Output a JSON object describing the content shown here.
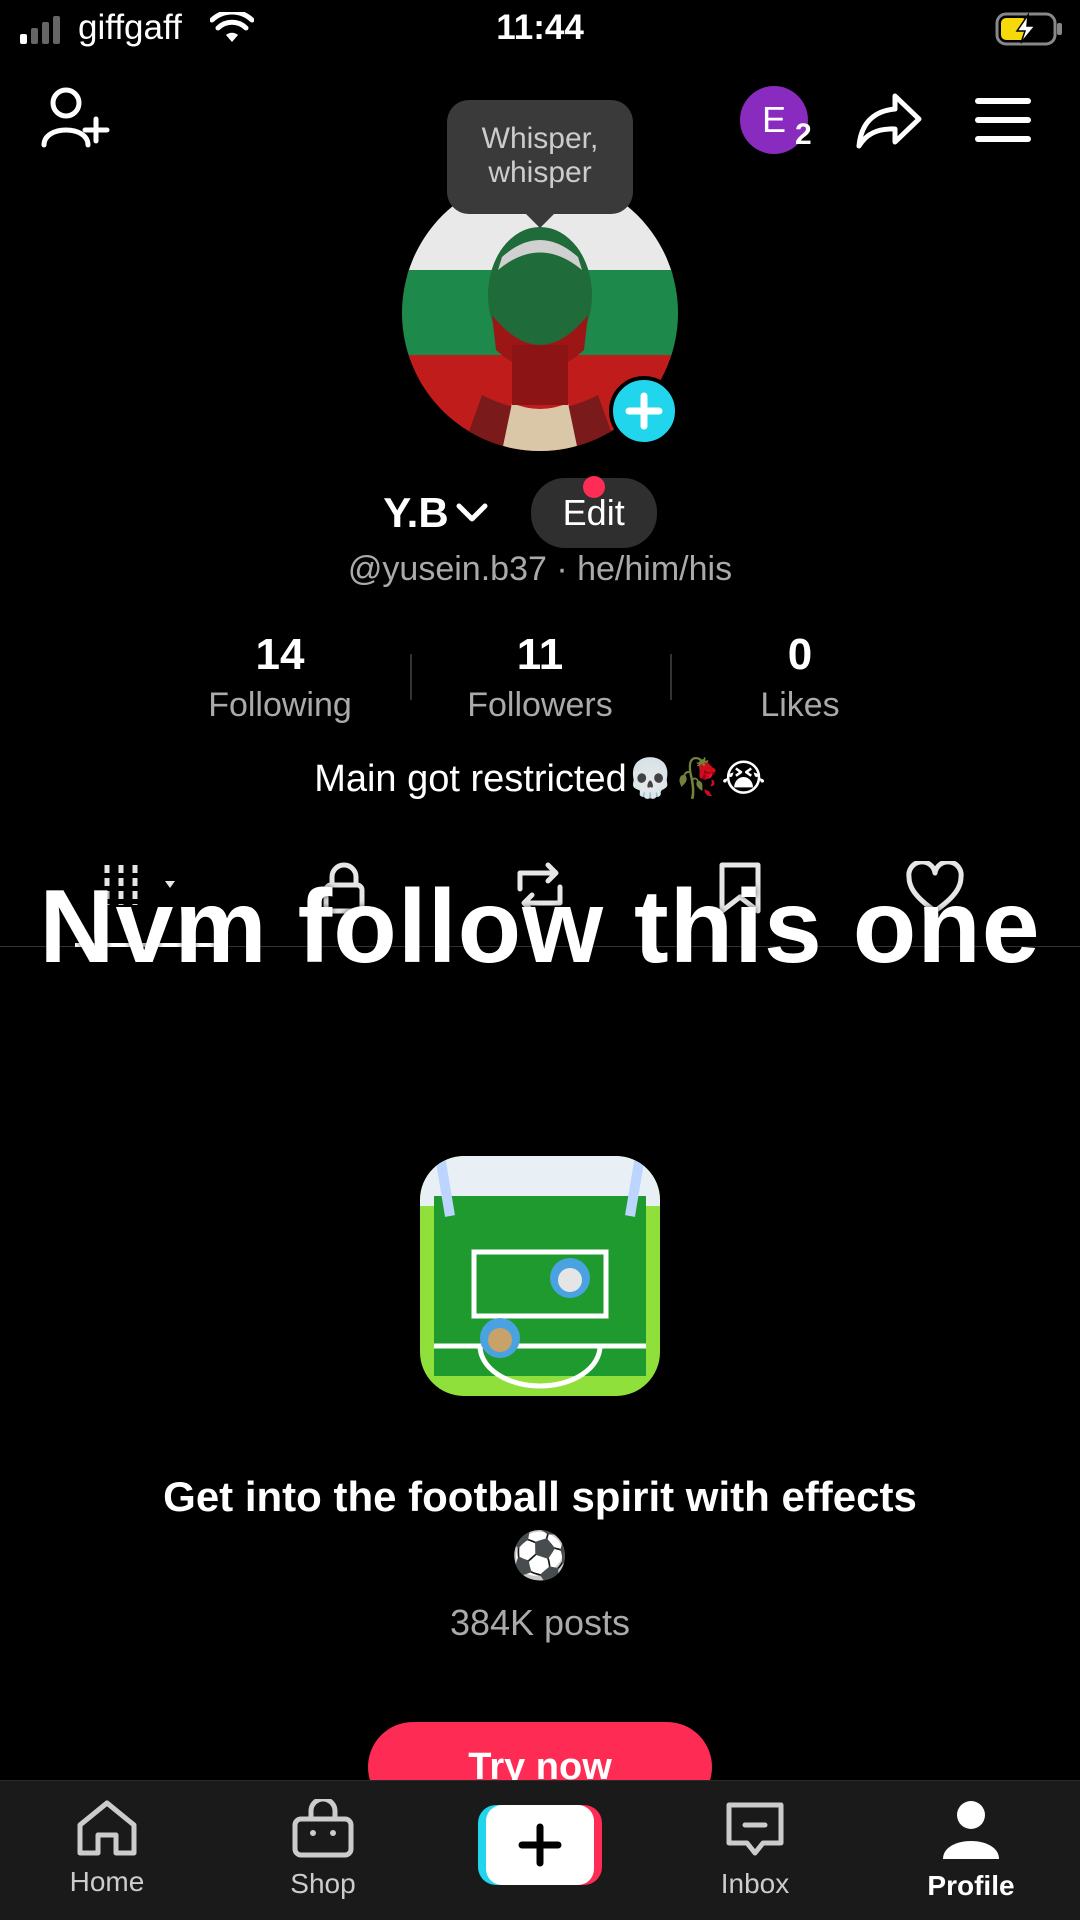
{
  "status_bar": {
    "carrier": "giffgaff",
    "time": "11:44"
  },
  "header": {
    "tooltip": "Whisper,\nwhisper",
    "avatar_letter": "E",
    "avatar_count": "2"
  },
  "profile": {
    "name": "Y.B",
    "edit_label": "Edit",
    "handle": "@yusein.b37 · he/him/his",
    "stats": [
      {
        "value": "14",
        "label": "Following"
      },
      {
        "value": "11",
        "label": "Followers"
      },
      {
        "value": "0",
        "label": "Likes"
      }
    ],
    "bio": "Main got restricted💀🥀😭"
  },
  "overlay_text": "Nvm follow this one",
  "promo": {
    "title": "Get into the football spirit with effects",
    "title_emoji": "⚽",
    "posts": "384K posts",
    "cta": "Try now"
  },
  "bottom_nav": [
    {
      "label": "Home",
      "icon": "home-icon"
    },
    {
      "label": "Shop",
      "icon": "shop-icon"
    },
    {
      "label": "",
      "icon": "create-icon"
    },
    {
      "label": "Inbox",
      "icon": "inbox-icon"
    },
    {
      "label": "Profile",
      "icon": "profile-icon",
      "active": true
    }
  ],
  "colors": {
    "accent": "#fe2c55",
    "cyan": "#20d5ec",
    "avatar_bg": "#8a2bbf"
  }
}
